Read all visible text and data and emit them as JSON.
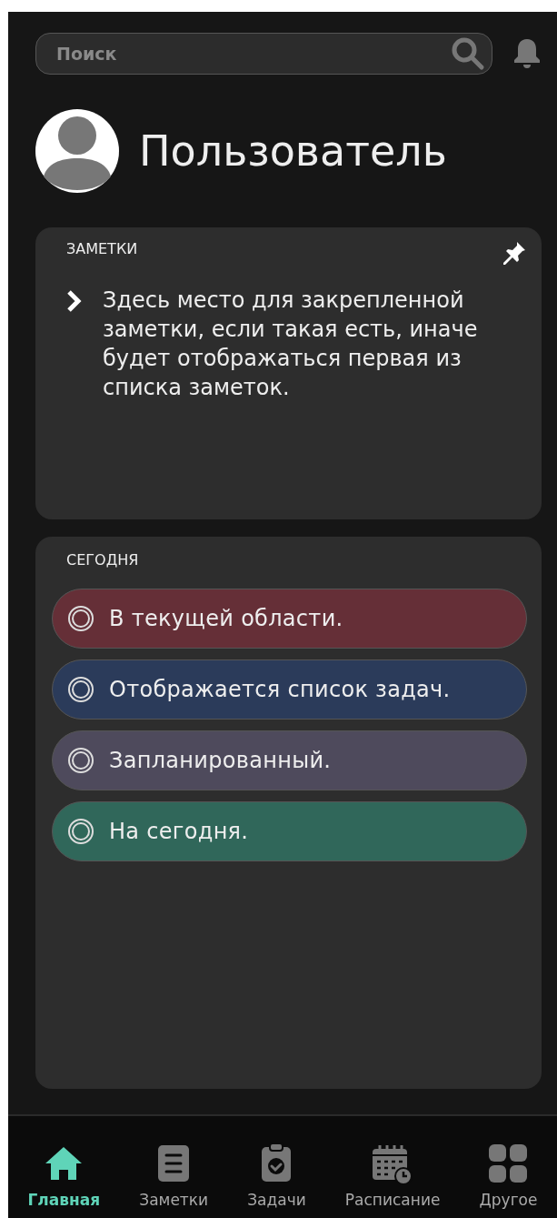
{
  "search": {
    "placeholder": "Поиск"
  },
  "user": {
    "name": "Пользователь"
  },
  "notes": {
    "title": "ЗАМЕТКИ",
    "text": "Здесь место для закрепленной заметки, если такая есть, иначе будет отображаться первая из списка заметок."
  },
  "today": {
    "title": "СЕГОДНЯ",
    "tasks": [
      {
        "label": "В текущей области.",
        "checked": false,
        "color": "#652f37"
      },
      {
        "label": "Отображается список задач.",
        "checked": false,
        "color": "#2b3b5a"
      },
      {
        "label": "Запланированный.",
        "checked": false,
        "color": "#4e4a5c"
      },
      {
        "label": "На сегодня.",
        "checked": false,
        "color": "#30675a"
      }
    ]
  },
  "nav": [
    {
      "label": "Главная",
      "kind": "home",
      "selected": true
    },
    {
      "label": "Заметки",
      "kind": "notes",
      "selected": false
    },
    {
      "label": "Задачи",
      "kind": "tasks",
      "selected": false
    },
    {
      "label": "Расписание",
      "kind": "schedule",
      "selected": false
    },
    {
      "label": "Другое",
      "kind": "other",
      "selected": false
    }
  ]
}
